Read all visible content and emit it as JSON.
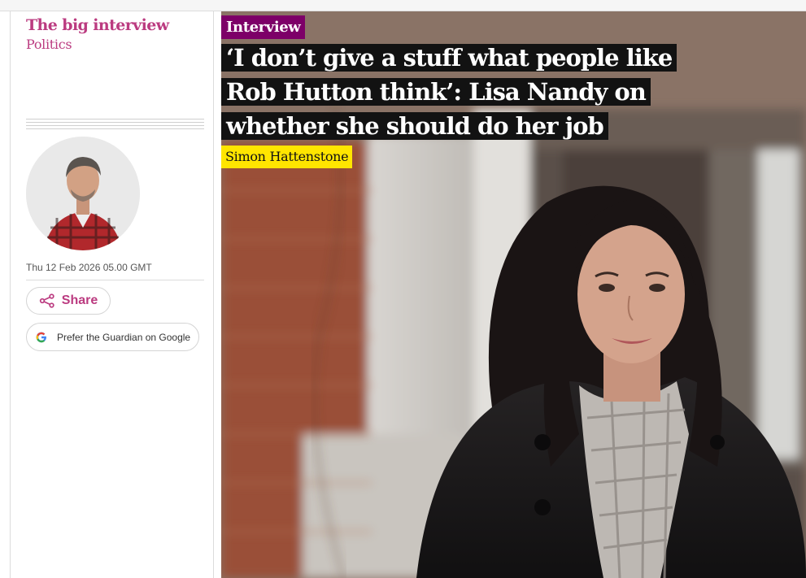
{
  "series_label": "The big interview",
  "section_label": "Politics",
  "kicker": "Interview",
  "headline": "‘I don’t give a stuff what people like Rob Hutton think’: Lisa Nandy on whether she should do  her job",
  "byline": "Simon Hattenstone",
  "dateline": "Thu 12 Feb 2026 05.00 GMT",
  "share_label": "Share",
  "google_label": "Prefer the Guardian on Google",
  "colors": {
    "accent": "#bb3b80",
    "kicker_bg": "#7d0068",
    "headline_bg": "#121212",
    "byline_bg": "#ffe500"
  },
  "icons": [
    "share-icon",
    "google-icon"
  ],
  "images": [
    "author-avatar",
    "hero-photo"
  ]
}
